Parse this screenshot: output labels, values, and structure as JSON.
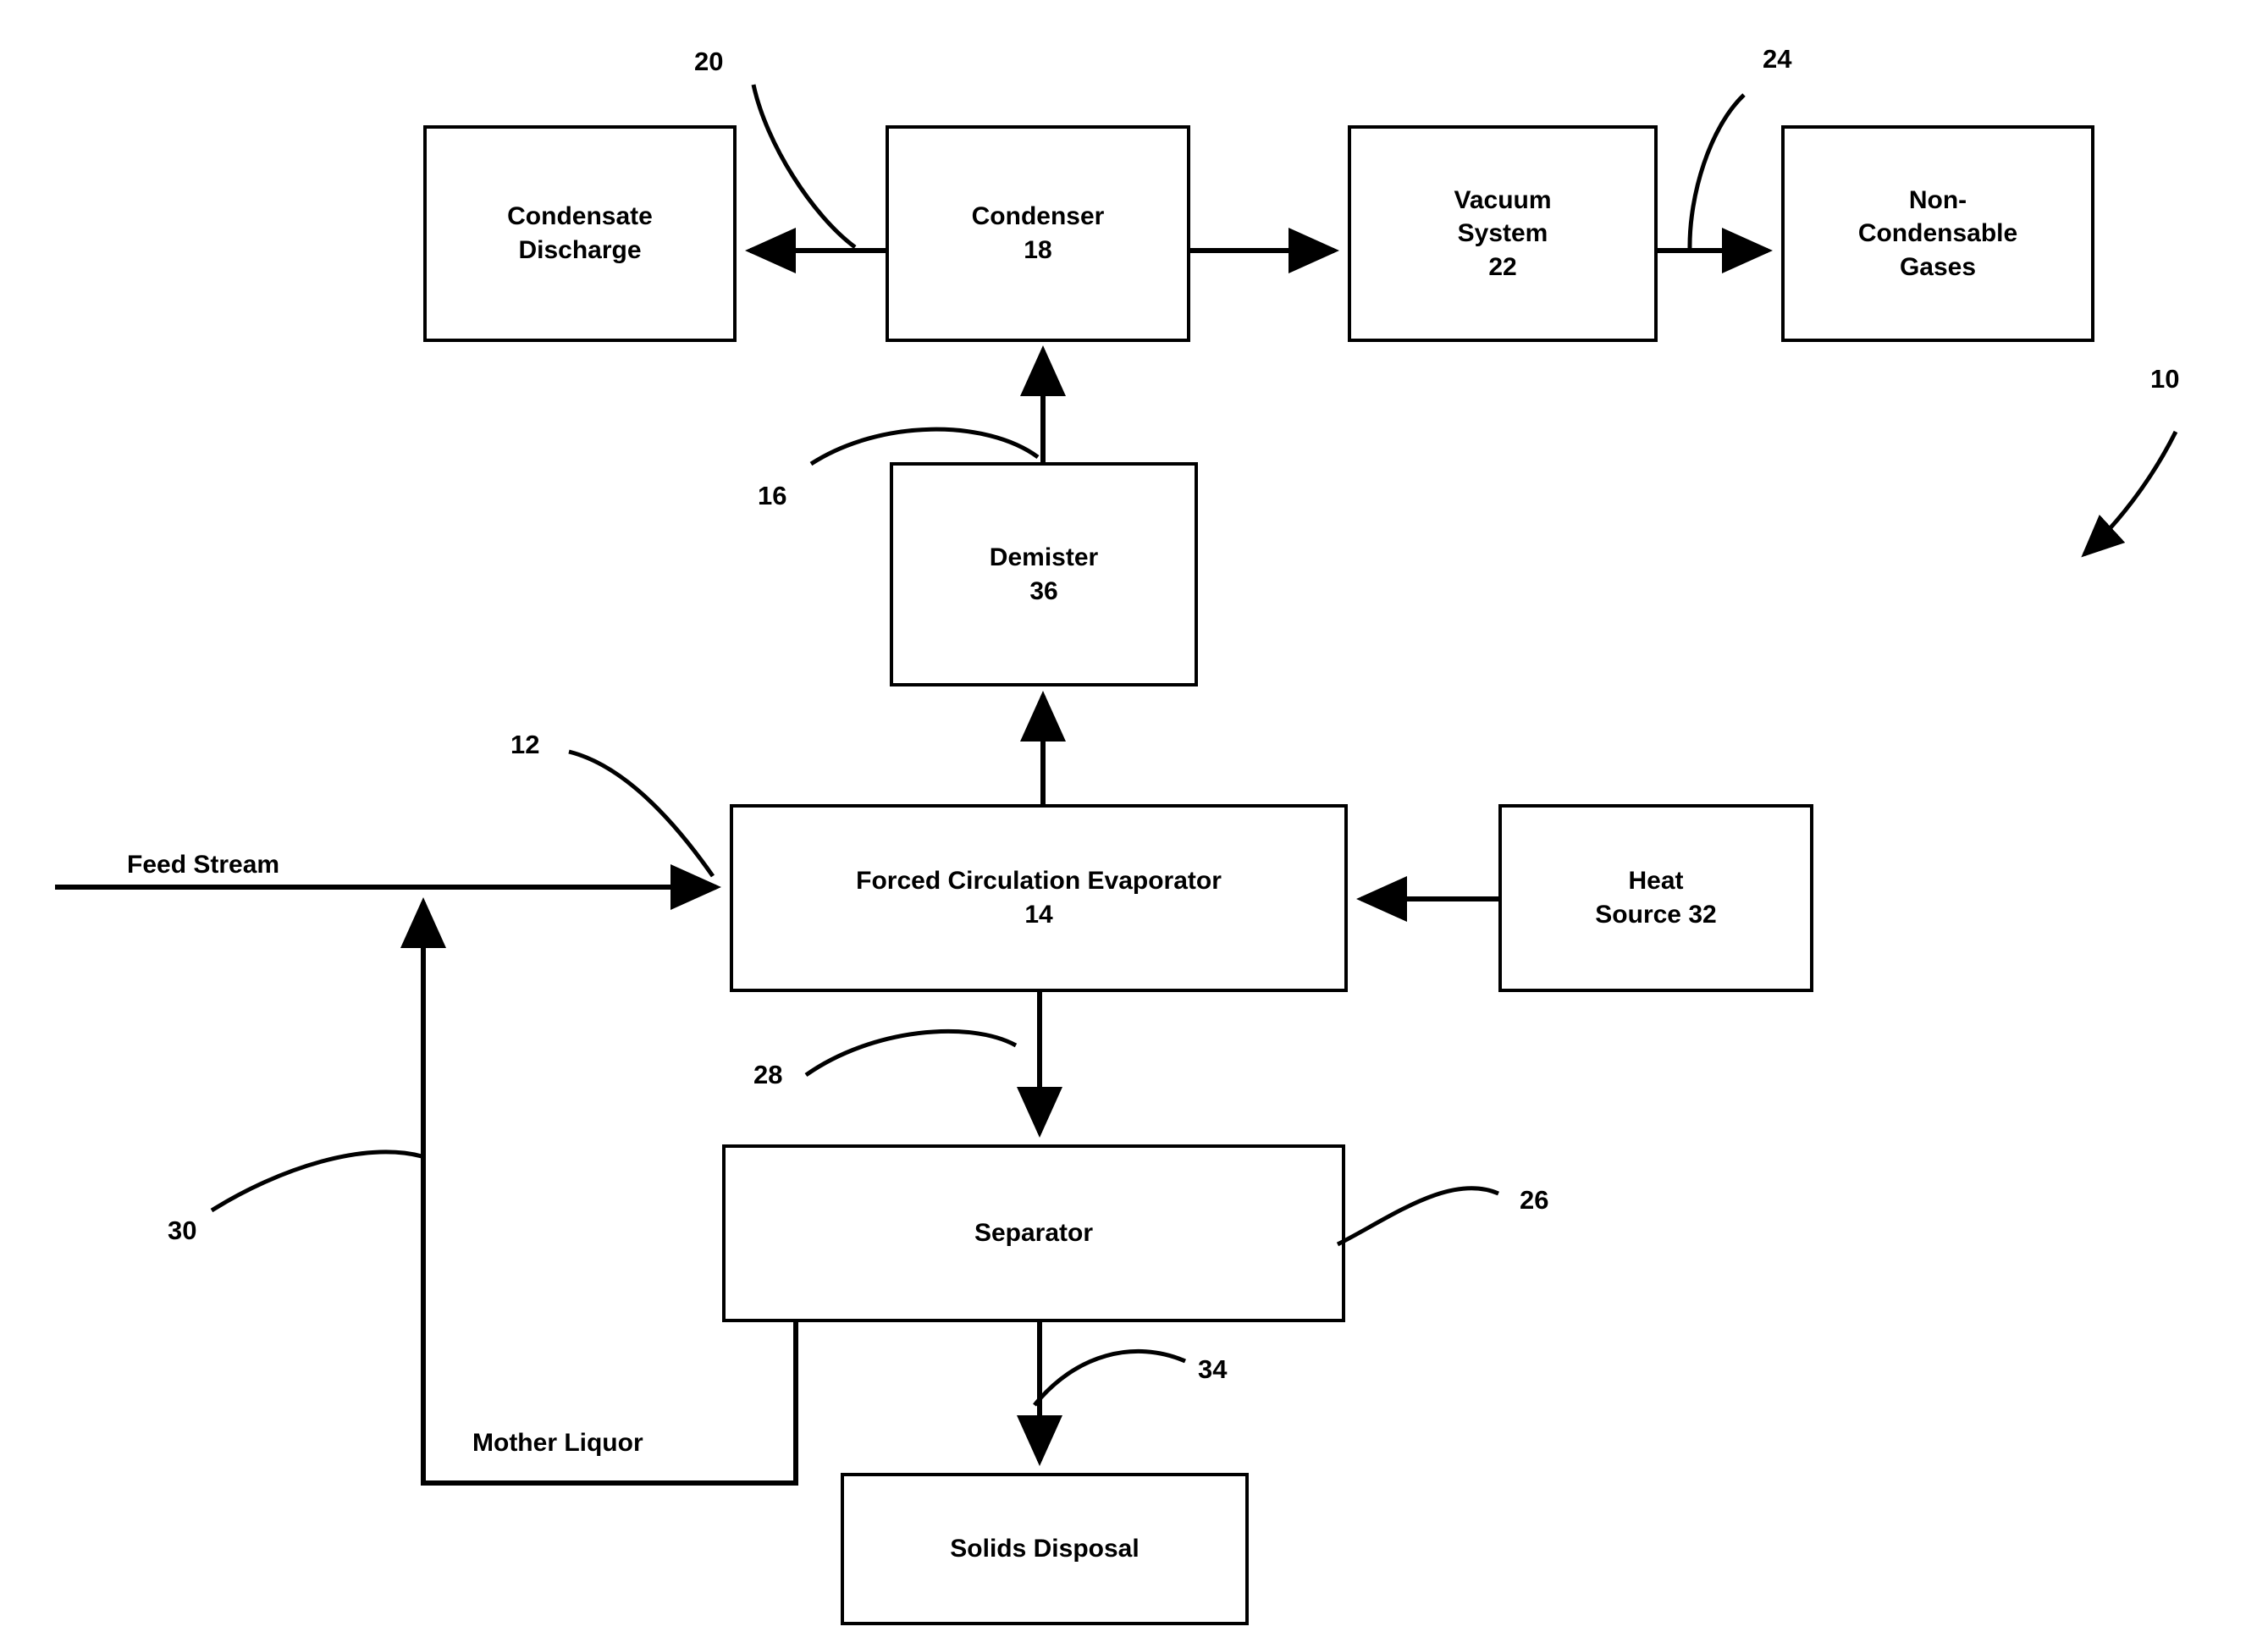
{
  "diagram": {
    "title_ref": "10",
    "boxes": [
      {
        "id": "condensate_discharge",
        "label": "Condensate\nDischarge"
      },
      {
        "id": "condenser",
        "label": "Condenser\n18"
      },
      {
        "id": "vacuum_system",
        "label": "Vacuum\nSystem\n22"
      },
      {
        "id": "non_condensable_gases",
        "label": "Non-\nCondensable\nGases"
      },
      {
        "id": "demister",
        "label": "Demister\n36"
      },
      {
        "id": "forced_circulation_evaporator",
        "label": "Forced Circulation Evaporator\n14"
      },
      {
        "id": "heat_source",
        "label": "Heat\nSource 32"
      },
      {
        "id": "separator",
        "label": "Separator"
      },
      {
        "id": "solids_disposal",
        "label": "Solids Disposal"
      }
    ],
    "stream_labels": [
      {
        "id": "feed_stream",
        "label": "Feed Stream"
      },
      {
        "id": "mother_liquor",
        "label": "Mother Liquor"
      }
    ],
    "reference_numerals": [
      {
        "id": "ref-20",
        "value": "20"
      },
      {
        "id": "ref-24",
        "value": "24"
      },
      {
        "id": "ref-10",
        "value": "10"
      },
      {
        "id": "ref-16",
        "value": "16"
      },
      {
        "id": "ref-12",
        "value": "12"
      },
      {
        "id": "ref-28",
        "value": "28"
      },
      {
        "id": "ref-26",
        "value": "26"
      },
      {
        "id": "ref-30",
        "value": "30"
      },
      {
        "id": "ref-34",
        "value": "34"
      }
    ]
  }
}
